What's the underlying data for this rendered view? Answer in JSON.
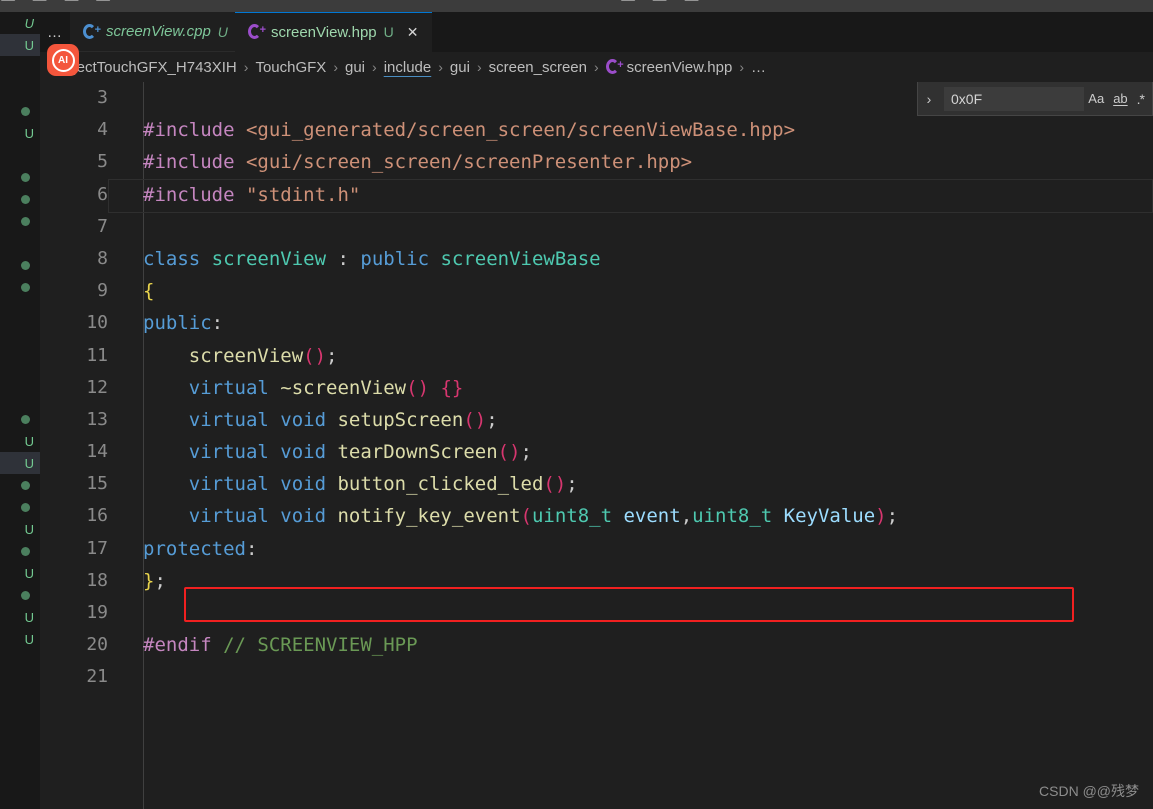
{
  "toolbar": {
    "left_icons": "⬜ ⬜  ⬜  ⬜",
    "right_icons": "⬜  ⬜  ⬜"
  },
  "tabs": {
    "overflow_label": "…",
    "items": [
      {
        "label": "screenView.cpp",
        "status": "U",
        "icon": "cpp-file-icon",
        "active": false,
        "closable": false
      },
      {
        "label": "screenView.hpp",
        "status": "U",
        "icon": "cpp-file-icon",
        "active": true,
        "closable": true,
        "close_label": "✕"
      }
    ]
  },
  "ai_badge": {
    "label": "AI"
  },
  "breadcrumb": {
    "separator": "›",
    "items": [
      {
        "label": "ojectTouchGFX_H743XIH",
        "icon": null
      },
      {
        "label": "TouchGFX",
        "icon": null
      },
      {
        "label": "gui",
        "icon": null
      },
      {
        "label": "include",
        "icon": null
      },
      {
        "label": "gui",
        "icon": null
      },
      {
        "label": "screen_screen",
        "icon": null
      },
      {
        "label": "screenView.hpp",
        "icon": "cpp-file-icon"
      },
      {
        "label": "…",
        "icon": null
      }
    ]
  },
  "find_widget": {
    "toggle_icon": "chevron-right-icon",
    "toggle_glyph": "›",
    "query": "0x0F",
    "placeholder": "Find",
    "options": [
      {
        "name": "match-case",
        "label": "Aa"
      },
      {
        "name": "match-whole-word",
        "label": "ab"
      },
      {
        "name": "use-regex",
        "label": ".*"
      }
    ]
  },
  "explorer": {
    "rows": [
      {
        "marker": "U",
        "italic": true,
        "selected": false,
        "name_cut": "."
      },
      {
        "marker": "U",
        "italic": false,
        "selected": true,
        "name_cut": "."
      },
      {
        "marker": "",
        "italic": false,
        "selected": false,
        "name_cut": ""
      },
      {
        "marker": "",
        "italic": false,
        "selected": false,
        "name_cut": ""
      },
      {
        "marker": "dot",
        "italic": false,
        "selected": false,
        "name_cut": ""
      },
      {
        "marker": "U",
        "italic": false,
        "selected": false,
        "name_cut": ""
      },
      {
        "marker": "",
        "italic": false,
        "selected": false,
        "name_cut": ""
      },
      {
        "marker": "dot",
        "italic": false,
        "selected": false,
        "name_cut": ""
      },
      {
        "marker": "dot",
        "italic": false,
        "selected": false,
        "name_cut": ""
      },
      {
        "marker": "dot",
        "italic": false,
        "selected": false,
        "name_cut": ""
      },
      {
        "marker": "",
        "italic": false,
        "selected": false,
        "name_cut": ""
      },
      {
        "marker": "dot",
        "italic": false,
        "selected": false,
        "name_cut": ""
      },
      {
        "marker": "dot",
        "italic": false,
        "selected": false,
        "name_cut": ""
      },
      {
        "marker": "",
        "italic": false,
        "selected": false,
        "name_cut": ""
      },
      {
        "marker": "",
        "italic": false,
        "selected": false,
        "name_cut": ""
      },
      {
        "marker": "",
        "italic": false,
        "selected": false,
        "name_cut": ""
      },
      {
        "marker": "",
        "italic": false,
        "selected": false,
        "name_cut": ""
      },
      {
        "marker": "",
        "italic": false,
        "selected": false,
        "name_cut": ""
      },
      {
        "marker": "dot",
        "italic": false,
        "selected": false,
        "name_cut": ""
      },
      {
        "marker": "U",
        "italic": false,
        "selected": false,
        "name_cut": ""
      },
      {
        "marker": "U",
        "italic": false,
        "selected": true,
        "name_cut": ""
      },
      {
        "marker": "dot",
        "italic": false,
        "selected": false,
        "name_cut": ""
      },
      {
        "marker": "dot",
        "italic": false,
        "selected": false,
        "name_cut": ""
      },
      {
        "marker": "U",
        "italic": false,
        "selected": false,
        "name_cut": ""
      },
      {
        "marker": "dot",
        "italic": false,
        "selected": false,
        "name_cut": ""
      },
      {
        "marker": "U",
        "italic": false,
        "selected": false,
        "name_cut": ""
      },
      {
        "marker": "dot",
        "italic": false,
        "selected": false,
        "name_cut": ""
      },
      {
        "marker": "U",
        "italic": false,
        "selected": false,
        "name_cut": ""
      },
      {
        "marker": "U",
        "italic": false,
        "selected": false,
        "name_cut": ""
      },
      {
        "marker": "",
        "italic": false,
        "selected": false,
        "name_cut": ""
      }
    ]
  },
  "editor": {
    "language": "cpp",
    "current_line": 6,
    "highlighted_line": 16,
    "lines": [
      {
        "number": "3",
        "tokens": []
      },
      {
        "number": "4",
        "tokens": [
          {
            "c": "t-pre",
            "t": "#include "
          },
          {
            "c": "t-str",
            "t": "<gui_generated/screen_screen/screenViewBase.hpp>"
          }
        ]
      },
      {
        "number": "5",
        "tokens": [
          {
            "c": "t-pre",
            "t": "#include "
          },
          {
            "c": "t-str",
            "t": "<gui/screen_screen/screenPresenter.hpp>"
          }
        ]
      },
      {
        "number": "6",
        "tokens": [
          {
            "c": "t-pre",
            "t": "#include "
          },
          {
            "c": "t-str",
            "t": "\"stdint.h\""
          }
        ]
      },
      {
        "number": "7",
        "tokens": []
      },
      {
        "number": "8",
        "tokens": [
          {
            "c": "t-kw",
            "t": "class "
          },
          {
            "c": "t-type",
            "t": "screenView"
          },
          {
            "c": "t-plain",
            "t": " "
          },
          {
            "c": "t-punc",
            "t": ":"
          },
          {
            "c": "t-plain",
            "t": " "
          },
          {
            "c": "t-kw",
            "t": "public "
          },
          {
            "c": "t-type",
            "t": "screenViewBase"
          }
        ]
      },
      {
        "number": "9",
        "tokens": [
          {
            "c": "t-brace",
            "t": "{"
          }
        ]
      },
      {
        "number": "10",
        "tokens": [
          {
            "c": "t-kw",
            "t": "public"
          },
          {
            "c": "t-punc",
            "t": ":"
          }
        ]
      },
      {
        "number": "11",
        "tokens": [
          {
            "c": "t-plain",
            "t": "    "
          },
          {
            "c": "t-fn",
            "t": "screenView"
          },
          {
            "c": "t-paren",
            "t": "()"
          },
          {
            "c": "t-plain",
            "t": ";"
          }
        ]
      },
      {
        "number": "12",
        "tokens": [
          {
            "c": "t-plain",
            "t": "    "
          },
          {
            "c": "t-kw",
            "t": "virtual "
          },
          {
            "c": "t-fn",
            "t": "~screenView"
          },
          {
            "c": "t-paren",
            "t": "()"
          },
          {
            "c": "t-plain",
            "t": " "
          },
          {
            "c": "t-paren",
            "t": "{}"
          }
        ]
      },
      {
        "number": "13",
        "tokens": [
          {
            "c": "t-plain",
            "t": "    "
          },
          {
            "c": "t-kw",
            "t": "virtual "
          },
          {
            "c": "t-kw",
            "t": "void "
          },
          {
            "c": "t-fn",
            "t": "setupScreen"
          },
          {
            "c": "t-paren",
            "t": "()"
          },
          {
            "c": "t-plain",
            "t": ";"
          }
        ]
      },
      {
        "number": "14",
        "tokens": [
          {
            "c": "t-plain",
            "t": "    "
          },
          {
            "c": "t-kw",
            "t": "virtual "
          },
          {
            "c": "t-kw",
            "t": "void "
          },
          {
            "c": "t-fn",
            "t": "tearDownScreen"
          },
          {
            "c": "t-paren",
            "t": "()"
          },
          {
            "c": "t-plain",
            "t": ";"
          }
        ]
      },
      {
        "number": "15",
        "tokens": [
          {
            "c": "t-plain",
            "t": "    "
          },
          {
            "c": "t-kw",
            "t": "virtual "
          },
          {
            "c": "t-kw",
            "t": "void "
          },
          {
            "c": "t-fn",
            "t": "button_clicked_led"
          },
          {
            "c": "t-paren",
            "t": "()"
          },
          {
            "c": "t-plain",
            "t": ";"
          }
        ]
      },
      {
        "number": "16",
        "tokens": [
          {
            "c": "t-plain",
            "t": "    "
          },
          {
            "c": "t-kw",
            "t": "virtual "
          },
          {
            "c": "t-kw",
            "t": "void "
          },
          {
            "c": "t-fn",
            "t": "notify_key_event"
          },
          {
            "c": "t-paren",
            "t": "("
          },
          {
            "c": "t-type",
            "t": "uint8_t "
          },
          {
            "c": "t-var",
            "t": "event"
          },
          {
            "c": "t-plain",
            "t": ","
          },
          {
            "c": "t-type",
            "t": "uint8_t "
          },
          {
            "c": "t-var",
            "t": "KeyValue"
          },
          {
            "c": "t-paren",
            "t": ")"
          },
          {
            "c": "t-plain",
            "t": ";"
          }
        ]
      },
      {
        "number": "17",
        "tokens": [
          {
            "c": "t-kw",
            "t": "protected"
          },
          {
            "c": "t-punc",
            "t": ":"
          }
        ]
      },
      {
        "number": "18",
        "tokens": [
          {
            "c": "t-brace",
            "t": "}"
          },
          {
            "c": "t-plain",
            "t": ";"
          }
        ]
      },
      {
        "number": "19",
        "tokens": []
      },
      {
        "number": "20",
        "tokens": [
          {
            "c": "t-pre",
            "t": "#endif "
          },
          {
            "c": "t-cmt",
            "t": "// SCREENVIEW_HPP"
          }
        ]
      },
      {
        "number": "21",
        "tokens": []
      }
    ]
  },
  "watermark": {
    "text": "CSDN @@残梦"
  },
  "colors": {
    "background": "#1f1f1f",
    "sidebar": "#181818",
    "accent": "#0078d4",
    "annotation": "#f02020",
    "git_untracked": "#73c991",
    "ai_badge": "#f4563c"
  }
}
